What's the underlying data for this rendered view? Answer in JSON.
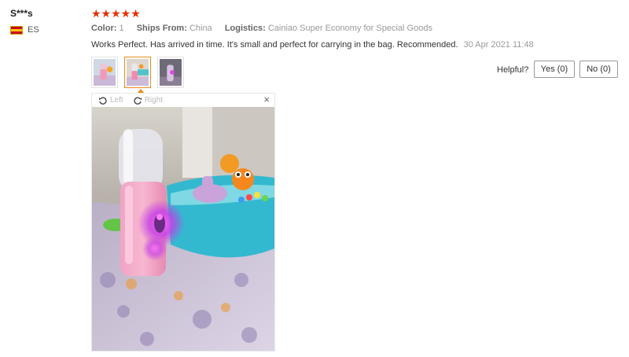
{
  "user": {
    "name": "S***s",
    "country": "ES"
  },
  "rating": {
    "stars": "★★★★★"
  },
  "meta": {
    "color_label": "Color:",
    "color_value": "1",
    "ships_label": "Ships From:",
    "ships_value": "China",
    "logistics_label": "Logistics:",
    "logistics_value": "Cainiao Super Economy for Special Goods"
  },
  "review": {
    "text": "Works Perfect. Has arrived in time. It's small and perfect for carrying in the bag. Recommended.",
    "date": "30 Apr 2021 11:48"
  },
  "viewer": {
    "rotate_left": "Left",
    "rotate_right": "Right",
    "close": "×"
  },
  "helpful": {
    "label": "Helpful?",
    "yes": "Yes (0)",
    "no": "No (0)"
  },
  "colors": {
    "star": "#e62e04",
    "active_thumb": "#f08c1a"
  }
}
